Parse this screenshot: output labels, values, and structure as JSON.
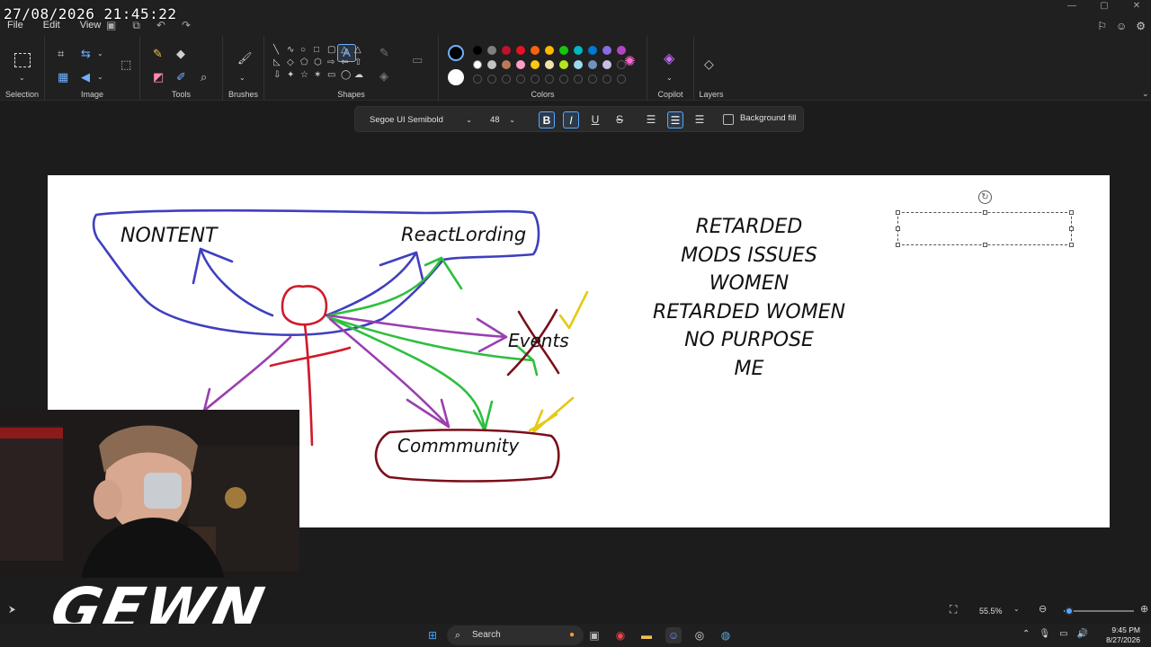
{
  "overlay": {
    "clock": "27/08/2026 21:45:22"
  },
  "menu": {
    "file": "File",
    "edit": "Edit",
    "view": "View"
  },
  "ribbon": {
    "groups": {
      "selection": "Selection",
      "image": "Image",
      "tools": "Tools",
      "brushes": "Brushes",
      "shapes": "Shapes",
      "colors": "Colors",
      "copilot": "Copilot",
      "layers": "Layers"
    },
    "palette_row1": [
      "#000000",
      "#7f7f7f",
      "#c0122a",
      "#e81123",
      "#f7630c",
      "#ffb900",
      "#16c60c",
      "#00b7c3",
      "#0078d4",
      "#886ce4",
      "#b146c2"
    ],
    "palette_row2": [
      "#ffffff",
      "#c3c3c3",
      "#b97a57",
      "#ff9ec7",
      "#ffc90e",
      "#efe4b0",
      "#b5e61d",
      "#99d9ea",
      "#7092be",
      "#c8bfe7"
    ],
    "primary_color": "#000000",
    "secondary_color": "#ffffff"
  },
  "text_toolbar": {
    "font_family": "Segoe UI Semibold",
    "font_size": "48",
    "bold": "B",
    "italic": "I",
    "underline": "U",
    "strikethrough": "S",
    "background_fill": "Background fill"
  },
  "canvas": {
    "labels": {
      "nontent": "NONTENT",
      "reactlording": "ReactLording",
      "events": "Events",
      "community": "Commmunity"
    },
    "list": [
      "RETARDED",
      "MODS ISSUES",
      "WOMEN",
      "RETARDED WOMEN",
      "NO PURPOSE",
      "ME"
    ]
  },
  "webcam": {
    "logo": "GEWN"
  },
  "status": {
    "zoom": "55.5%",
    "zoom_level": 0.555
  },
  "taskbar": {
    "search": "Search",
    "time": "9:45 PM",
    "date": "8/27/2026"
  }
}
